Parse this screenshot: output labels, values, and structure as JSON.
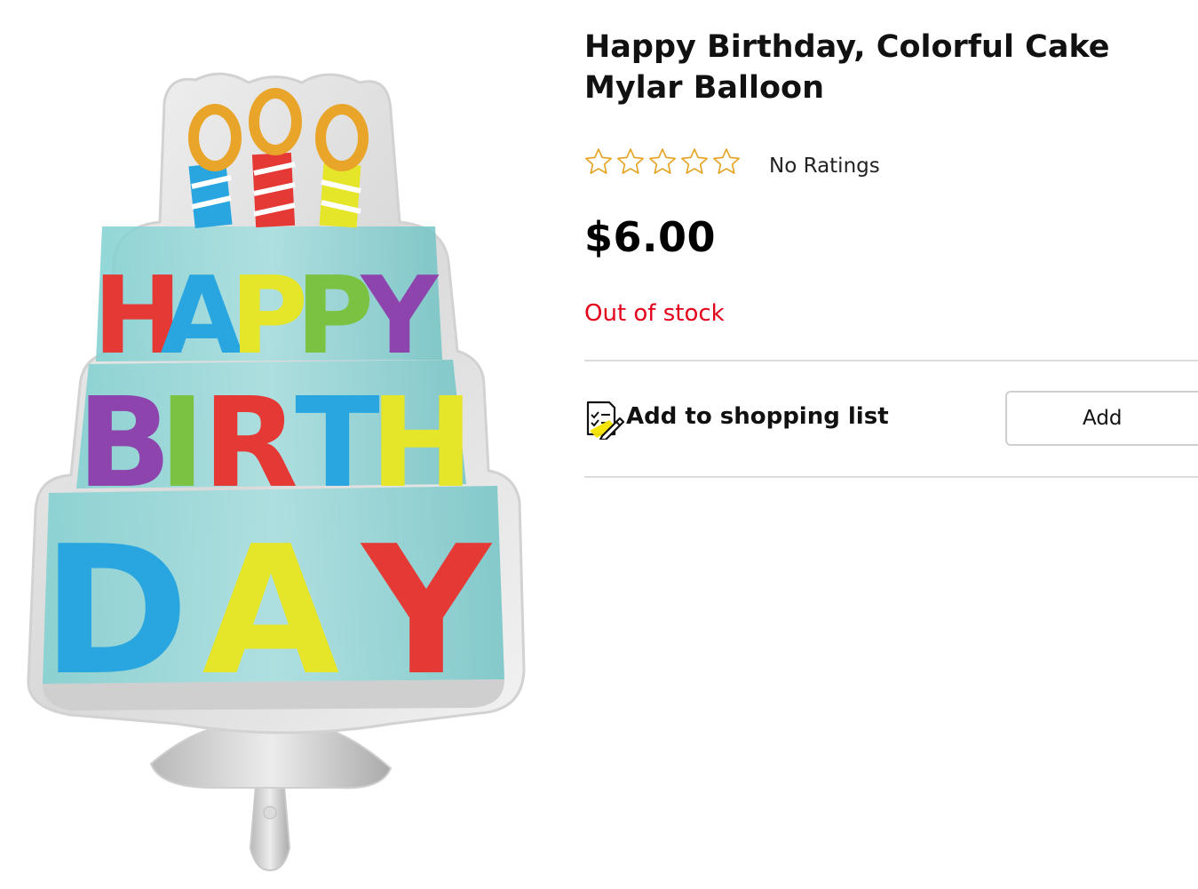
{
  "product": {
    "title": "Happy Birthday, Colorful Cake Mylar Balloon",
    "rating": {
      "value": 0,
      "max": 5,
      "label": "No Ratings",
      "star_color": "#e5a321"
    },
    "price": "$6.00",
    "stock_status": "Out of stock",
    "stock_color": "#e2001a",
    "image": {
      "icon": "happy-birthday-cake-balloon",
      "balloon_text": [
        "HAPPY",
        "BIRTH",
        "DAY"
      ]
    }
  },
  "shopping_list": {
    "icon": "checklist-pencil-icon",
    "label": "Add to shopping list",
    "button_label": "Add"
  }
}
